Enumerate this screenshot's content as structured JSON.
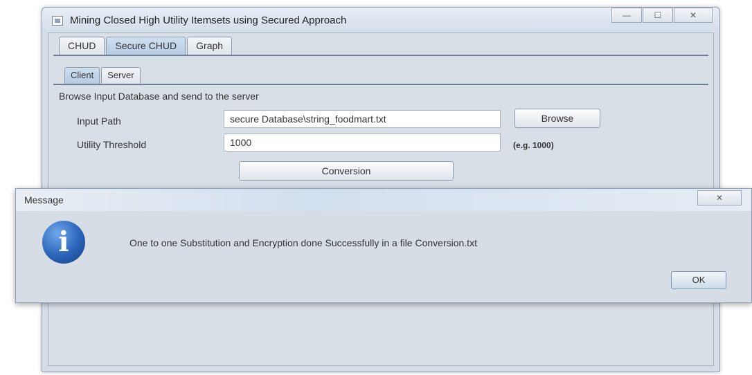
{
  "window": {
    "title": "Mining Closed High Utility Itemsets using Secured Approach",
    "controls": {
      "minimize": "—",
      "maximize": "☐",
      "close": "✕"
    }
  },
  "tabs": [
    "CHUD",
    "Secure CHUD",
    "Graph"
  ],
  "active_tab": "Secure CHUD",
  "subtabs": [
    "Client",
    "Server"
  ],
  "active_subtab": "Client",
  "client": {
    "section_label": "Browse Input Database and send to the server",
    "input_path_label": "Input Path",
    "input_path_value": "secure Database\\string_foodmart.txt",
    "browse_label": "Browse",
    "threshold_label": "Utility Threshold",
    "threshold_value": "1000",
    "threshold_hint": "(e.g. 1000)",
    "conversion_label": "Conversion"
  },
  "dialog": {
    "title": "Message",
    "close": "✕",
    "icon": "info-icon",
    "icon_glyph": "i",
    "message": "One to one Substitution and Encryption done Successfully in a file Conversion.txt",
    "ok_label": "OK"
  }
}
